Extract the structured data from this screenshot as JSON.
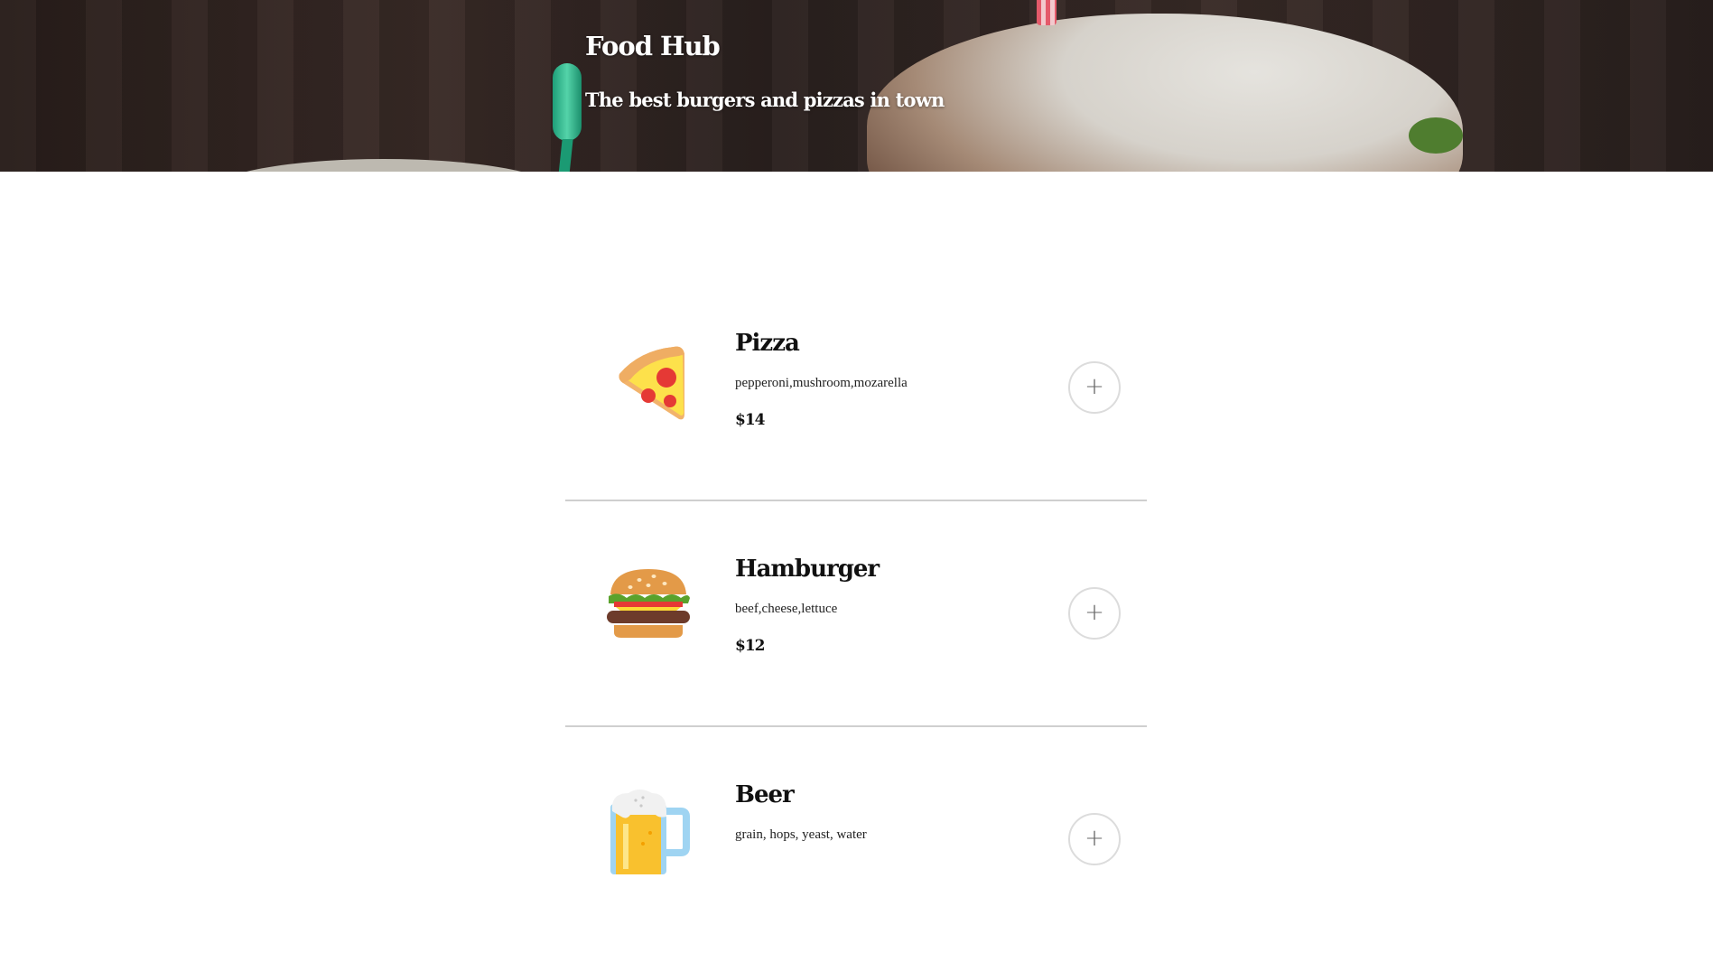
{
  "hero": {
    "title": "Food Hub",
    "subtitle": "The best burgers and pizzas in town"
  },
  "menu": {
    "items": [
      {
        "name": "Pizza",
        "description": "pepperoni,mushroom,mozarella",
        "price": "$14",
        "icon": "pizza-icon",
        "add_label": "+"
      },
      {
        "name": "Hamburger",
        "description": "beef,cheese,lettuce",
        "price": "$12",
        "icon": "hamburger-icon",
        "add_label": "+"
      },
      {
        "name": "Beer",
        "description": "grain, hops, yeast, water",
        "price": "",
        "icon": "beer-icon",
        "add_label": "+"
      }
    ]
  }
}
